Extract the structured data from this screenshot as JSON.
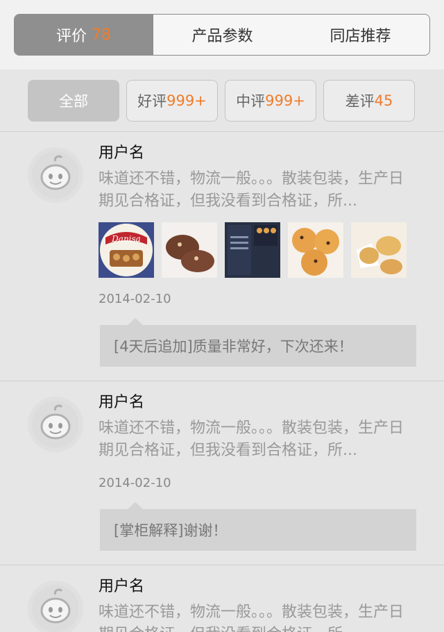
{
  "tabs": [
    {
      "label": "评价",
      "count": "78"
    },
    {
      "label": "产品参数"
    },
    {
      "label": "同店推荐"
    }
  ],
  "filters": [
    {
      "label": "全部",
      "count": ""
    },
    {
      "label": "好评",
      "count": "999+"
    },
    {
      "label": "中评",
      "count": "999+"
    },
    {
      "label": "差评",
      "count": "45"
    }
  ],
  "reviews": [
    {
      "username": "用户名",
      "text": "味道还不错，物流一般。。。散装包装，生产日期见合格证，但我没看到合格证，所...",
      "date": "2014-02-10",
      "reply": "[4天后追加]质量非常好，下次还来！",
      "photos": [
        "danisa-tin-photo",
        "chocolate-cookies-photo",
        "cookie-box-photo",
        "raisin-cookies-photo",
        "butter-cookies-photo"
      ]
    },
    {
      "username": "用户名",
      "text": "味道还不错，物流一般。。。散装包装，生产日期见合格证，但我没看到合格证，所...",
      "date": "2014-02-10",
      "reply": "[掌柜解释]谢谢！"
    },
    {
      "username": "用户名",
      "text": "味道还不错，物流一般。。。散装包装，生产日期见合格证，但我没看到合格证，所..."
    }
  ],
  "photo_logo_text": "Danisa",
  "colors": {
    "accent": "#f07c29",
    "tab_active": "#8f8f8f",
    "reply_bg": "#d3d3d3"
  }
}
